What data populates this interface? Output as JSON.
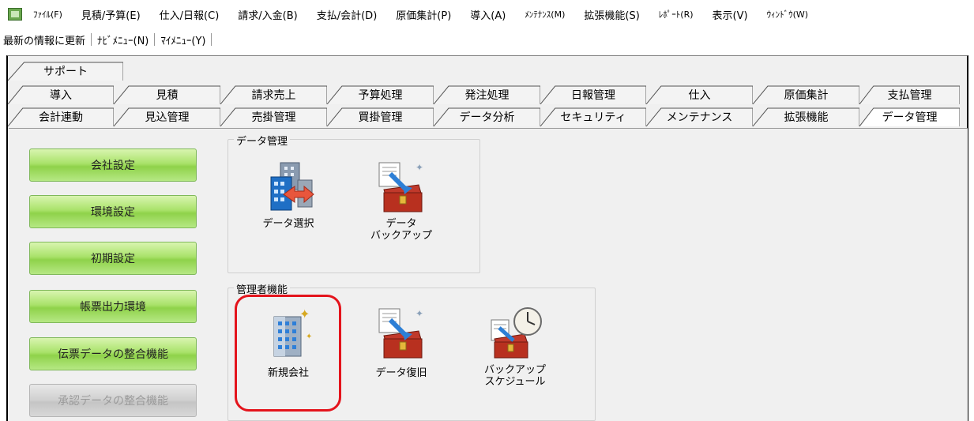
{
  "menubar": {
    "items": [
      {
        "label": "ﾌｧｲﾙ(F)",
        "small": true
      },
      {
        "label": "見積/予算(E)",
        "small": false
      },
      {
        "label": "仕入/日報(C)",
        "small": false
      },
      {
        "label": "請求/入金(B)",
        "small": false
      },
      {
        "label": "支払/会計(D)",
        "small": false
      },
      {
        "label": "原価集計(P)",
        "small": false
      },
      {
        "label": "導入(A)",
        "small": false
      },
      {
        "label": "ﾒﾝﾃﾅﾝｽ(M)",
        "small": true
      },
      {
        "label": "拡張機能(S)",
        "small": false
      },
      {
        "label": "ﾚﾎﾟｰﾄ(R)",
        "small": true
      },
      {
        "label": "表示(V)",
        "small": false
      },
      {
        "label": "ｳｨﾝﾄﾞｳ(W)",
        "small": true
      }
    ]
  },
  "toolbar": {
    "refresh": "最新の情報に更新",
    "navi_menu": "ﾅﾋﾞﾒﾆｭｰ(N)",
    "my_menu": "ﾏｲﾒﾆｭｰ(Y)"
  },
  "tabs": {
    "row1": [
      "サポート"
    ],
    "row2": [
      "導入",
      "見積",
      "請求売上",
      "予算処理",
      "発注処理",
      "日報管理",
      "仕入",
      "原価集計",
      "支払管理"
    ],
    "row3": [
      "会計連動",
      "見込管理",
      "売掛管理",
      "買掛管理",
      "データ分析",
      "セキュリティ",
      "メンテナンス",
      "拡張機能",
      "データ管理"
    ],
    "active": "データ管理"
  },
  "left_buttons": [
    {
      "label": "会社設定",
      "enabled": true
    },
    {
      "label": "環境設定",
      "enabled": true
    },
    {
      "label": "初期設定",
      "enabled": true
    },
    {
      "label": "帳票出力環境",
      "enabled": true
    },
    {
      "label": "伝票データの整合機能",
      "enabled": true
    },
    {
      "label": "承認データの整合機能",
      "enabled": false
    }
  ],
  "groups": {
    "data_management": {
      "title": "データ管理",
      "tiles": [
        {
          "label": "データ選択",
          "icon": "building-transfer-icon"
        },
        {
          "label": "データ\nバックアップ",
          "icon": "treasure-chest-backup-icon"
        }
      ]
    },
    "admin": {
      "title": "管理者機能",
      "tiles": [
        {
          "label": "新規会社",
          "icon": "new-company-building-icon",
          "highlighted": true
        },
        {
          "label": "データ復旧",
          "icon": "treasure-chest-restore-icon"
        },
        {
          "label": "バックアップ\nスケジュール",
          "icon": "backup-schedule-clock-icon"
        }
      ]
    }
  },
  "colors": {
    "highlight": "#e4141c",
    "button_green": "#a9e26a"
  }
}
